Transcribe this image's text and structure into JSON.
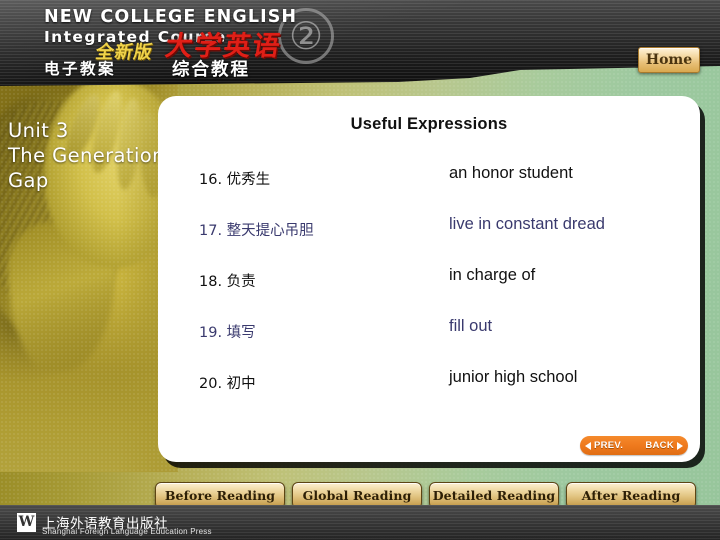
{
  "header": {
    "line1": "NEW COLLEGE ENGLISH",
    "line2": "Integrated Course",
    "line3": "电子教案",
    "cn_new_edition": "全新版",
    "cn_title": "大学英语",
    "cn_subtitle": "综合教程",
    "volume_badge": "②",
    "home_label": "Home"
  },
  "unit": {
    "line1": "Unit 3",
    "line2": "The  Generation",
    "line3": "Gap"
  },
  "card": {
    "title": "Useful Expressions",
    "rows": [
      {
        "cn": "16. 优秀生",
        "en": "an honor student",
        "color": "#111111"
      },
      {
        "cn": "17. 整天提心吊胆",
        "en": "live in constant dread",
        "color": "#3a3a6e"
      },
      {
        "cn": "18. 负责",
        "en": "in charge of",
        "color": "#111111"
      },
      {
        "cn": "19. 填写",
        "en": "fill out",
        "color": "#3a3a6e"
      },
      {
        "cn": "20. 初中",
        "en": "junior high school",
        "color": "#111111"
      }
    ],
    "nav": {
      "prev_label": "PREV.",
      "back_label": "BACK"
    }
  },
  "bottom_bar": {
    "buttons": [
      {
        "label": "Before Reading"
      },
      {
        "label": "Global Reading"
      },
      {
        "label": "Detailed Reading"
      },
      {
        "label": "After Reading"
      }
    ]
  },
  "publisher": {
    "mark": "W",
    "cn": "上海外语教育出版社",
    "en": "Shanghai Foreign Language Education Press"
  },
  "colors": {
    "accent_orange": "#ef7a1e",
    "panel_green": "#97c59c",
    "panel_olive": "#8a7a1e",
    "gold_button": "#e2c583",
    "navy_text": "#3a3a6e"
  }
}
